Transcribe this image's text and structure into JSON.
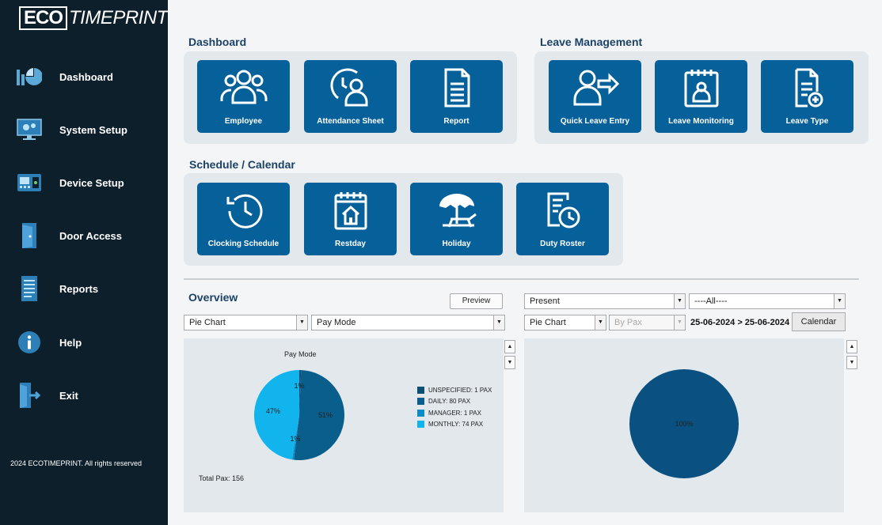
{
  "brand": {
    "eco": "ECO",
    "rest": "TIMEPRINT"
  },
  "sidebar": {
    "items": [
      {
        "label": "Dashboard",
        "icon": "dashboard-icon"
      },
      {
        "label": "System Setup",
        "icon": "system-setup-icon"
      },
      {
        "label": "Device Setup",
        "icon": "device-setup-icon"
      },
      {
        "label": "Door Access",
        "icon": "door-icon"
      },
      {
        "label": "Reports",
        "icon": "reports-icon"
      },
      {
        "label": "Help",
        "icon": "help-icon"
      },
      {
        "label": "Exit",
        "icon": "exit-icon"
      }
    ],
    "footer": "2024 ECOTIMEPRINT. All rights reserved"
  },
  "dashboard": {
    "title": "Dashboard",
    "tiles": [
      {
        "label": "Employee",
        "icon": "employee-icon"
      },
      {
        "label": "Attendance Sheet",
        "icon": "attendance-icon"
      },
      {
        "label": "Report",
        "icon": "report-icon"
      }
    ]
  },
  "leave": {
    "title": "Leave Management",
    "tiles": [
      {
        "label": "Quick Leave Entry",
        "icon": "quick-leave-icon"
      },
      {
        "label": "Leave Monitoring",
        "icon": "leave-monitoring-icon"
      },
      {
        "label": "Leave Type",
        "icon": "leave-type-icon"
      }
    ]
  },
  "schedule": {
    "title": "Schedule / Calendar",
    "tiles": [
      {
        "label": "Clocking Schedule",
        "icon": "clock-icon"
      },
      {
        "label": "Restday",
        "icon": "restday-icon"
      },
      {
        "label": "Holiday",
        "icon": "holiday-icon"
      },
      {
        "label": "Duty Roster",
        "icon": "duty-roster-icon"
      }
    ]
  },
  "overview": {
    "title": "Overview",
    "preview_label": "Preview",
    "left": {
      "chart_type": "Pie Chart",
      "group_by": "Pay Mode"
    },
    "right": {
      "status": "Present",
      "filter": "----All----",
      "chart_type": "Pie Chart",
      "by": "By Pax",
      "date_range": "25-06-2024 > 25-06-2024",
      "calendar_label": "Calendar"
    },
    "total_pax": "Total Pax: 156"
  },
  "chart_data": [
    {
      "type": "pie",
      "title": "Pay Mode",
      "categories": [
        "UNSPECIFIED: 1 PAX",
        "DAILY: 80 PAX",
        "MANAGER: 1 PAX",
        "MONTHLY: 74 PAX"
      ],
      "values": [
        1,
        80,
        1,
        74
      ],
      "slice_labels": [
        "1%",
        "51%",
        "1%",
        "47%"
      ],
      "colors": [
        "#0d4f73",
        "#0a5e8c",
        "#0b8cc9",
        "#12b4ee"
      ],
      "legend": "right"
    },
    {
      "type": "pie",
      "title": "",
      "categories": [
        ""
      ],
      "values": [
        100
      ],
      "slice_labels": [
        "100%"
      ],
      "colors": [
        "#0a5080"
      ],
      "legend": "none"
    }
  ],
  "colors": {
    "sidebar": "#0d1f2b",
    "tile": "#06609a",
    "group": "#e3e8ec",
    "heading": "#1c4267"
  }
}
